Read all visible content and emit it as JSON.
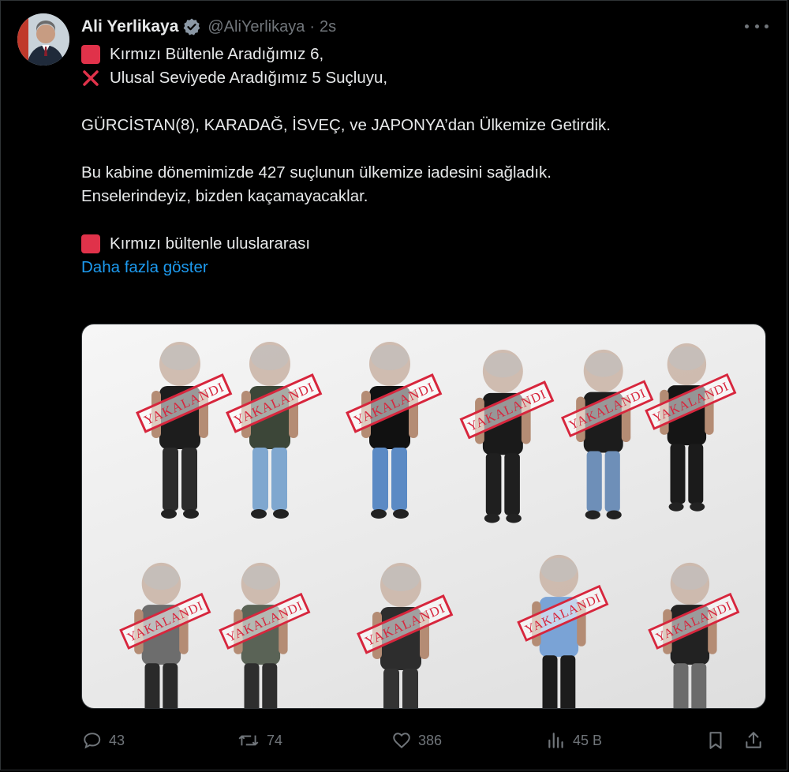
{
  "tweet": {
    "author_name": "Ali Yerlikaya",
    "handle": "@AliYerlikaya",
    "separator": "·",
    "time": "2s",
    "lines": [
      "Kırmızı Bültenle Aradığımız 6,",
      "Ulusal Seviyede Aradığımız 5 Suçluyu,",
      "GÜRCİSTAN(8), KARADAĞ, İSVEÇ, ve JAPONYA’dan Ülkemize Getirdik.",
      "Bu kabine dönemimizde 427 suçlunun ülkemize iadesini sağladık.",
      "Enselerindeyiz, bizden kaçamayacaklar.",
      "Kırmızı bültenle uluslararası"
    ],
    "show_more": "Daha fazla göster"
  },
  "media": {
    "stamp_text": "YAKALANDI",
    "person_count": 11
  },
  "actions": {
    "replies": "43",
    "reposts": "74",
    "likes": "386",
    "views": "45 B"
  },
  "icons": [
    "verified-badge-icon",
    "more-icon",
    "red-square-icon",
    "red-x-icon",
    "reply-icon",
    "repost-icon",
    "like-icon",
    "views-icon",
    "bookmark-icon",
    "share-icon"
  ],
  "colors": {
    "background": "#000000",
    "text": "#e7e9ea",
    "muted": "#71767b",
    "link": "#1d9bf0",
    "red_square": "#e0324a",
    "stamp": "#d7263d"
  }
}
